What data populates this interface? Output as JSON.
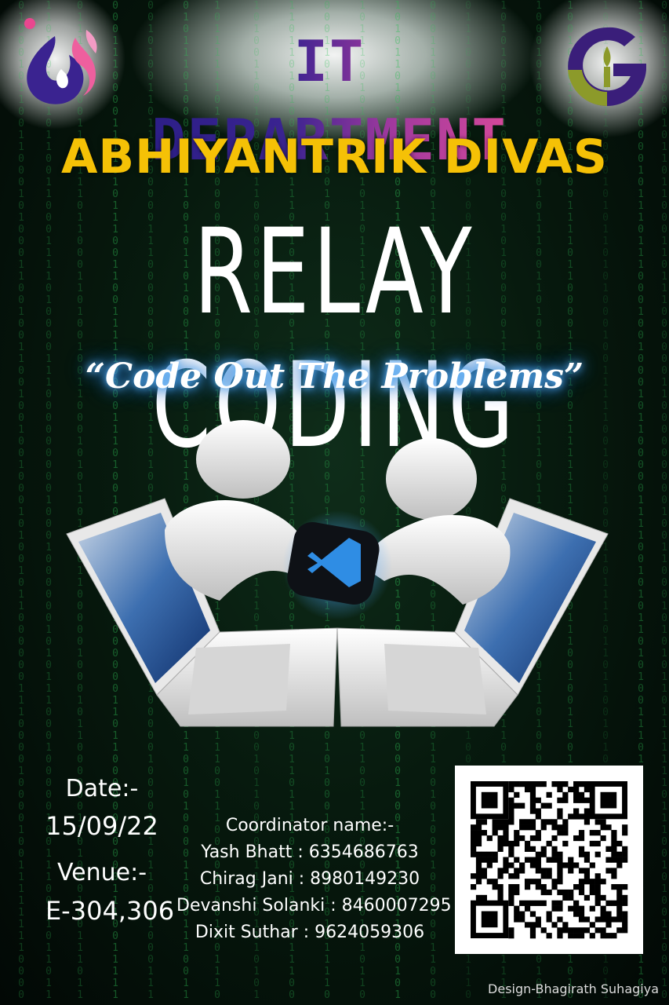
{
  "header": {
    "department": "IT DEPARTMENT",
    "event": "ABHIYANTRIK DIVAS"
  },
  "main": {
    "title": "RELAY CODING",
    "tagline": "“Code Out The Problems”"
  },
  "details": {
    "date_label": "Date:-",
    "date_value": "15/09/22",
    "venue_label": "Venue:-",
    "venue_value": "E-304,306"
  },
  "coordinators": {
    "title": "Coordinator name:-",
    "people": [
      "Yash Bhatt : 6354686763",
      "Chirag Jani : 8980149230",
      "Devanshi Solanki : 8460007295",
      "Dixit Suthar : 9624059306"
    ]
  },
  "footer": {
    "credit": "Design-Bhagirath Suhagiya"
  },
  "colors": {
    "background": "#071a0e",
    "matrix_green": "#2fbf55",
    "event_yellow": "#f5c106",
    "dept_purple": "#2a1e86",
    "dept_pink": "#e04c99",
    "tagline_glow": "#5fb7ff"
  },
  "icons": [
    "flame-logo-icon",
    "g-logo-icon",
    "vscode-icon",
    "qr-code-icon"
  ]
}
